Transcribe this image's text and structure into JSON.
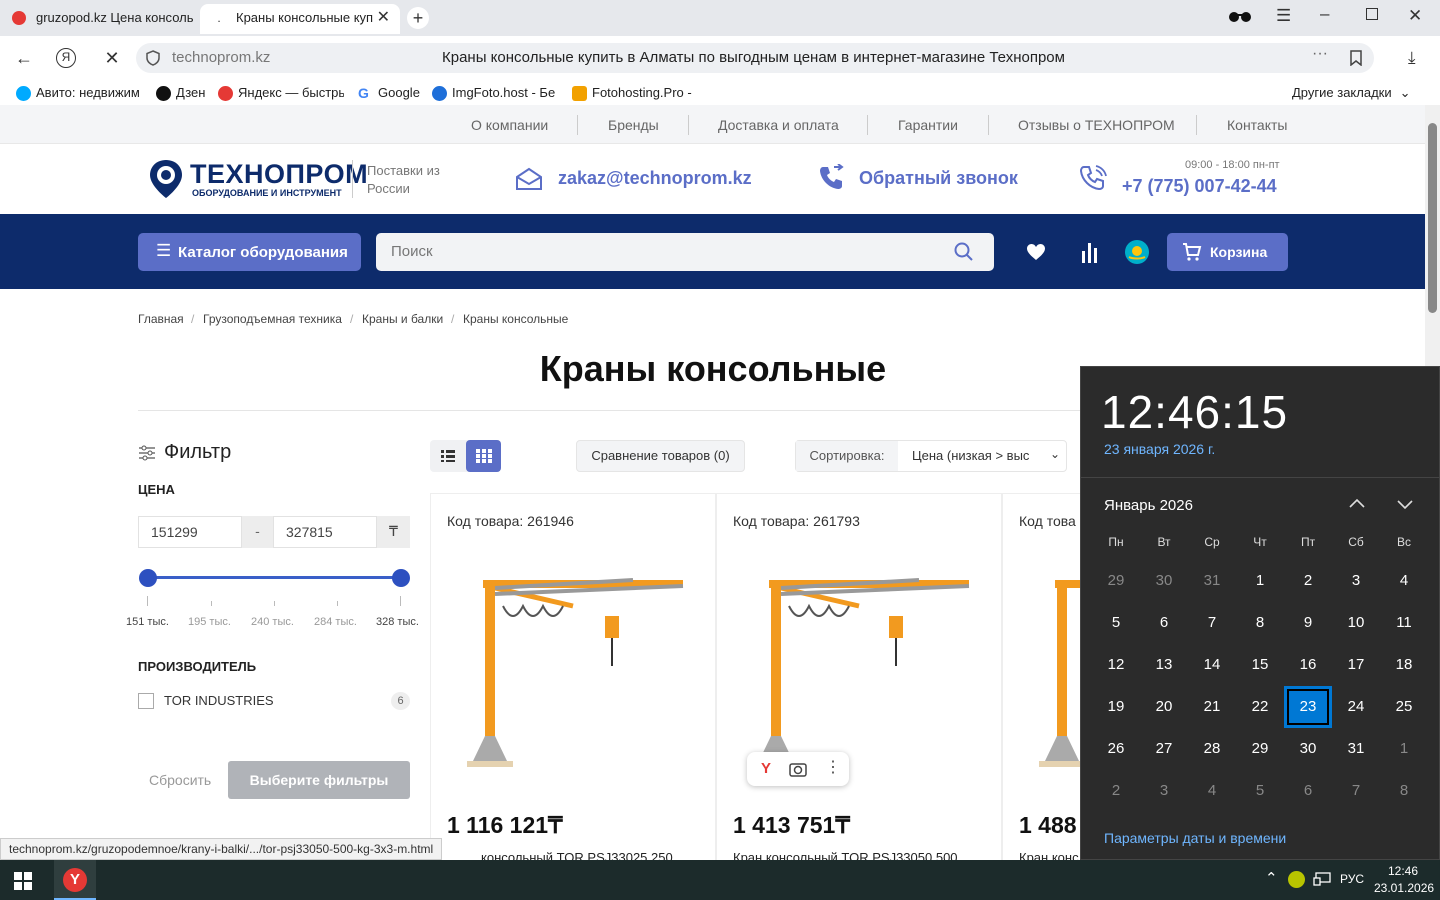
{
  "browser": {
    "tabs": [
      {
        "label": "gruzopod.kz Цена консоль",
        "active": false
      },
      {
        "label": "Краны консольные куп",
        "active": true
      }
    ],
    "address": {
      "domain": "technoprom.kz",
      "page_title": "Краны консольные купить в Алматы по выгодным ценам в интернет-магазине Технопром"
    },
    "bookmarks": [
      {
        "label": "Авито: недвижим",
        "icon": "avito-icon"
      },
      {
        "label": "Дзен",
        "icon": "dzen-icon"
      },
      {
        "label": "Яндекс — быстрь",
        "icon": "yandex-icon"
      },
      {
        "label": "Google",
        "icon": "google-icon"
      },
      {
        "label": "ImgFoto.host - Бе",
        "icon": "imgfoto-icon"
      },
      {
        "label": "Fotohosting.Pro -",
        "icon": "fotohosting-icon"
      }
    ],
    "other_bookmarks": "Другие закладки",
    "status_url": "technoprom.kz/gruzopodemnoe/krany-i-balki/.../tor-psj33050-500-kg-3x3-m.html"
  },
  "site": {
    "topnav": [
      "О компании",
      "Бренды",
      "Доставка и оплата",
      "Гарантии",
      "Отзывы о ТЕХНОПРОМ",
      "Контакты"
    ],
    "logo_name": "ТЕХНОПРОМ",
    "logo_tagline": "ОБОРУДОВАНИЕ И ИНСТРУМЕНТ",
    "supplies_line1": "Поставки из",
    "supplies_line2": "России",
    "email": "zakaz@technoprom.kz",
    "callback": "Обратный звонок",
    "hours": "09:00 - 18:00 пн-пт",
    "phone": "+7 (775) 007-42-44",
    "catalog_button": "Каталог оборудования",
    "search_placeholder": "Поиск",
    "cart_button": "Корзина"
  },
  "breadcrumbs": [
    "Главная",
    "Грузоподъемная техника",
    "Краны и балки",
    "Краны консольные"
  ],
  "page_title": "Краны консольные",
  "filter": {
    "title": "Фильтр",
    "price_label": "ЦЕНА",
    "price_min": "151299",
    "price_max": "327815",
    "price_sep": "-",
    "currency": "₸",
    "ticks": [
      "151 тыс.",
      "195 тыс.",
      "240 тыс.",
      "284 тыс.",
      "328 тыс."
    ],
    "manufacturer_label": "ПРОИЗВОДИТЕЛЬ",
    "manufacturers": [
      {
        "name": "TOR INDUSTRIES",
        "count": "6"
      }
    ],
    "reset": "Сбросить",
    "apply": "Выберите фильтры"
  },
  "toolbar": {
    "compare": "Сравнение товаров (0)",
    "sort_label": "Сортировка:",
    "sort_value": "Цена (низкая > выс"
  },
  "products": [
    {
      "code": "Код товара: 261946",
      "price": "1 116 121₸",
      "name": "консольный TOR PSJ33025 250"
    },
    {
      "code": "Код товара: 261793",
      "price": "1 413 751₸",
      "name": "Кран консольный TOR PSJ33050 500"
    },
    {
      "code": "Код това",
      "price": "1 488",
      "name": "Кран конс"
    }
  ],
  "calendar": {
    "time": "12:46:15",
    "date": "23 января 2026 г.",
    "month": "Январь 2026",
    "weekdays": [
      "Пн",
      "Вт",
      "Ср",
      "Чт",
      "Пт",
      "Сб",
      "Вс"
    ],
    "weeks": [
      [
        "29",
        "30",
        "31",
        "1",
        "2",
        "3",
        "4"
      ],
      [
        "5",
        "6",
        "7",
        "8",
        "9",
        "10",
        "11"
      ],
      [
        "12",
        "13",
        "14",
        "15",
        "16",
        "17",
        "18"
      ],
      [
        "19",
        "20",
        "21",
        "22",
        "23",
        "24",
        "25"
      ],
      [
        "26",
        "27",
        "28",
        "29",
        "30",
        "31",
        "1"
      ],
      [
        "2",
        "3",
        "4",
        "5",
        "6",
        "7",
        "8"
      ]
    ],
    "today": "23",
    "settings_link": "Параметры даты и времени"
  },
  "taskbar": {
    "lang": "РУС",
    "time": "12:46",
    "date": "23.01.2026"
  },
  "colors": {
    "brand_blue": "#0d2b6b",
    "accent": "#5b6ec7",
    "crane_orange": "#f29a1f",
    "calendar_bg": "#2b2b2b",
    "calendar_today": "#0078d4"
  }
}
